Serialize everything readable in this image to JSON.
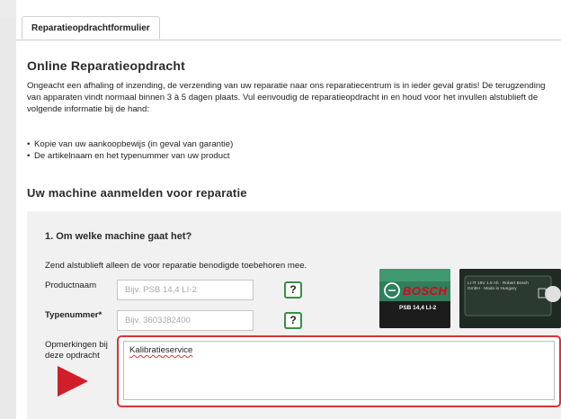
{
  "tab": {
    "label": "Reparatieopdrachtformulier"
  },
  "page": {
    "title": "Online Reparatieopdracht",
    "intro": "Ongeacht een afhaling of inzending, de verzending van uw reparatie naar ons reparatiecentrum is in ieder geval gratis! De terugzending van apparaten vindt normaal binnen 3 à 5 dagen plaats. Vul eenvoudig de reparatieopdracht in en houd voor het invullen alstublieft de volgende informatie bij de hand:",
    "bullets": [
      "Kopie van uw aankoopbewijs (in geval van garantie)",
      "De artikelnaam en het typenummer van uw product"
    ],
    "section_title": "Uw machine aanmelden voor reparatie"
  },
  "form": {
    "question": "1. Om welke machine gaat het?",
    "note": "Zend alstublieft alleen de voor reparatie benodigde toebehoren mee.",
    "product_label": "Productnaam",
    "product_placeholder": "Bijv. PSB 14,4 LI-2",
    "type_label": "Typenummer*",
    "type_placeholder": "Bijv. 3603J82400",
    "help_label": "?",
    "remarks_label": "Opmerkingen bij deze opdracht",
    "remarks_value": "Kalibratieservice"
  },
  "photos": {
    "brand": "BOSCH",
    "model": "PSB 14,4 LI-2",
    "plate_text": "LI-IT 18V 1.5 Ah · Robert Bosch GmbH · Made in Hungary"
  },
  "colors": {
    "highlight": "#d9333b",
    "arrow": "#d01f2a",
    "help_border": "#3a8f46",
    "brand_red": "#e2001a",
    "tool_green": "#2f7f5c"
  }
}
